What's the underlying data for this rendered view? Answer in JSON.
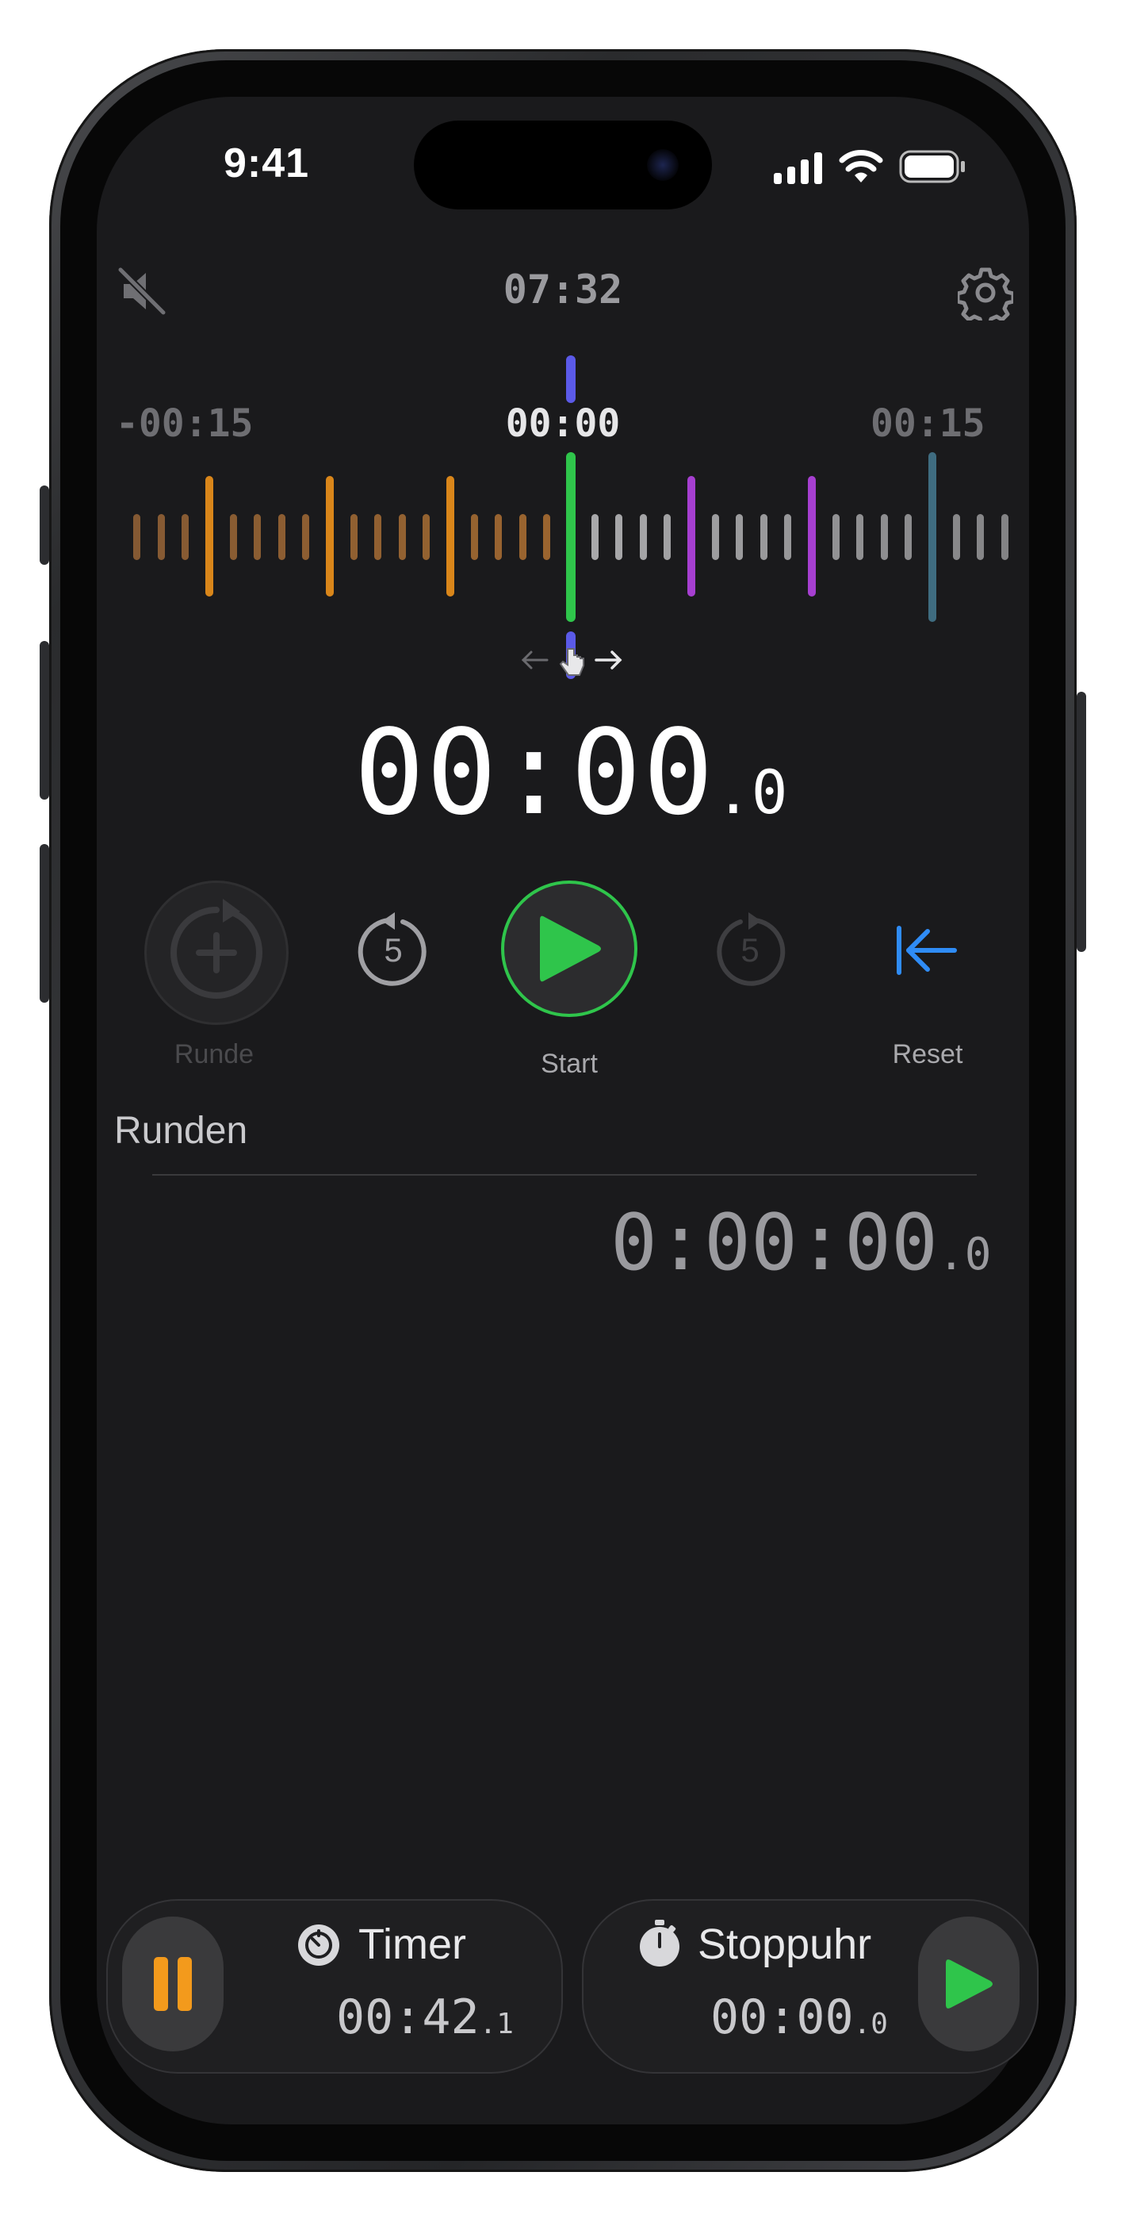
{
  "status_bar": {
    "time": "9:41"
  },
  "header": {
    "clock": "07:32",
    "mute_icon": "speaker-slash-icon",
    "settings_icon": "gear-icon"
  },
  "timeline": {
    "left_label": "-00:15",
    "center_label": "00:00",
    "right_label": "00:15",
    "scrub_hint_icon": "hand-drag-icon",
    "colors": {
      "red": "#8f2f2f",
      "orange": "#d9861a",
      "green": "#2fc54b",
      "purple": "#a63fd0",
      "teal": "#3f6c80",
      "indicator": "#5b5ae8"
    }
  },
  "main_time": {
    "main": "00:00",
    "fraction": ".0"
  },
  "controls": {
    "lap": {
      "label": "Runde",
      "icon": "lap-add-icon"
    },
    "back5": {
      "value": "5",
      "icon": "rewind-5-icon"
    },
    "start": {
      "label": "Start",
      "icon": "play-icon",
      "color": "#2fc54b"
    },
    "fwd5": {
      "value": "5",
      "icon": "forward-5-icon"
    },
    "reset": {
      "label": "Reset",
      "icon": "arrow-to-start-icon",
      "color": "#2f8cf6"
    }
  },
  "laps": {
    "title": "Runden",
    "total_main": "0:00:00",
    "total_fraction": ".0"
  },
  "bottom_cards": {
    "timer": {
      "title": "Timer",
      "icon": "timer-icon",
      "time_main": "00:42",
      "time_fraction": ".1",
      "button_icon": "pause-icon",
      "button_color": "#f39a1c"
    },
    "stopwatch": {
      "title": "Stoppuhr",
      "icon": "stopwatch-icon",
      "time_main": "00:00",
      "time_fraction": ".0",
      "button_icon": "play-icon",
      "button_color": "#2fc54b"
    }
  }
}
